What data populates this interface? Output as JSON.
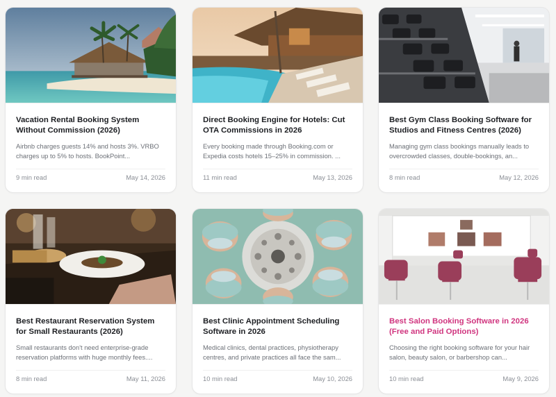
{
  "posts": [
    {
      "title": "Vacation Rental Booking System Without Commission (2026)",
      "excerpt": "Airbnb charges guests 14% and hosts 3%. VRBO charges up to 5% to hosts. BookPoint...",
      "read_time": "9 min read",
      "date": "May 14, 2026",
      "image": "tropical-villa-photo"
    },
    {
      "title": "Direct Booking Engine for Hotels: Cut OTA Commissions in 2026",
      "excerpt": "Every booking made through Booking.com or Expedia costs hotels 15–25% in commission. ...",
      "read_time": "11 min read",
      "date": "May 13, 2026",
      "image": "resort-pool-photo"
    },
    {
      "title": "Best Gym Class Booking Software for Studios and Fitness Centres (2026)",
      "excerpt": "Managing gym class bookings manually leads to overcrowded classes, double-bookings, an...",
      "read_time": "8 min read",
      "date": "May 12, 2026",
      "image": "gym-dumbbells-photo"
    },
    {
      "title": "Best Restaurant Reservation System for Small Restaurants (2026)",
      "excerpt": "Small restaurants don't need enterprise-grade reservation platforms with huge monthly fees....",
      "read_time": "8 min read",
      "date": "May 11, 2026",
      "image": "restaurant-dinner-photo"
    },
    {
      "title": "Best Clinic Appointment Scheduling Software in 2026",
      "excerpt": "Medical clinics, dental practices, physiotherapy centres, and private practices all face the sam...",
      "read_time": "10 min read",
      "date": "May 10, 2026",
      "image": "surgeons-lamp-photo"
    },
    {
      "title": "Best Salon Booking Software in 2026 (Free and Paid Options)",
      "excerpt": "Choosing the right booking software for your hair salon, beauty salon, or barbershop can...",
      "read_time": "10 min read",
      "date": "May 9, 2026",
      "image": "hair-salon-photo"
    }
  ],
  "colors": {
    "title": "#1d1f23",
    "title_hover": "#d0357f",
    "excerpt": "#6b6f76",
    "meta": "#8a8e95"
  }
}
